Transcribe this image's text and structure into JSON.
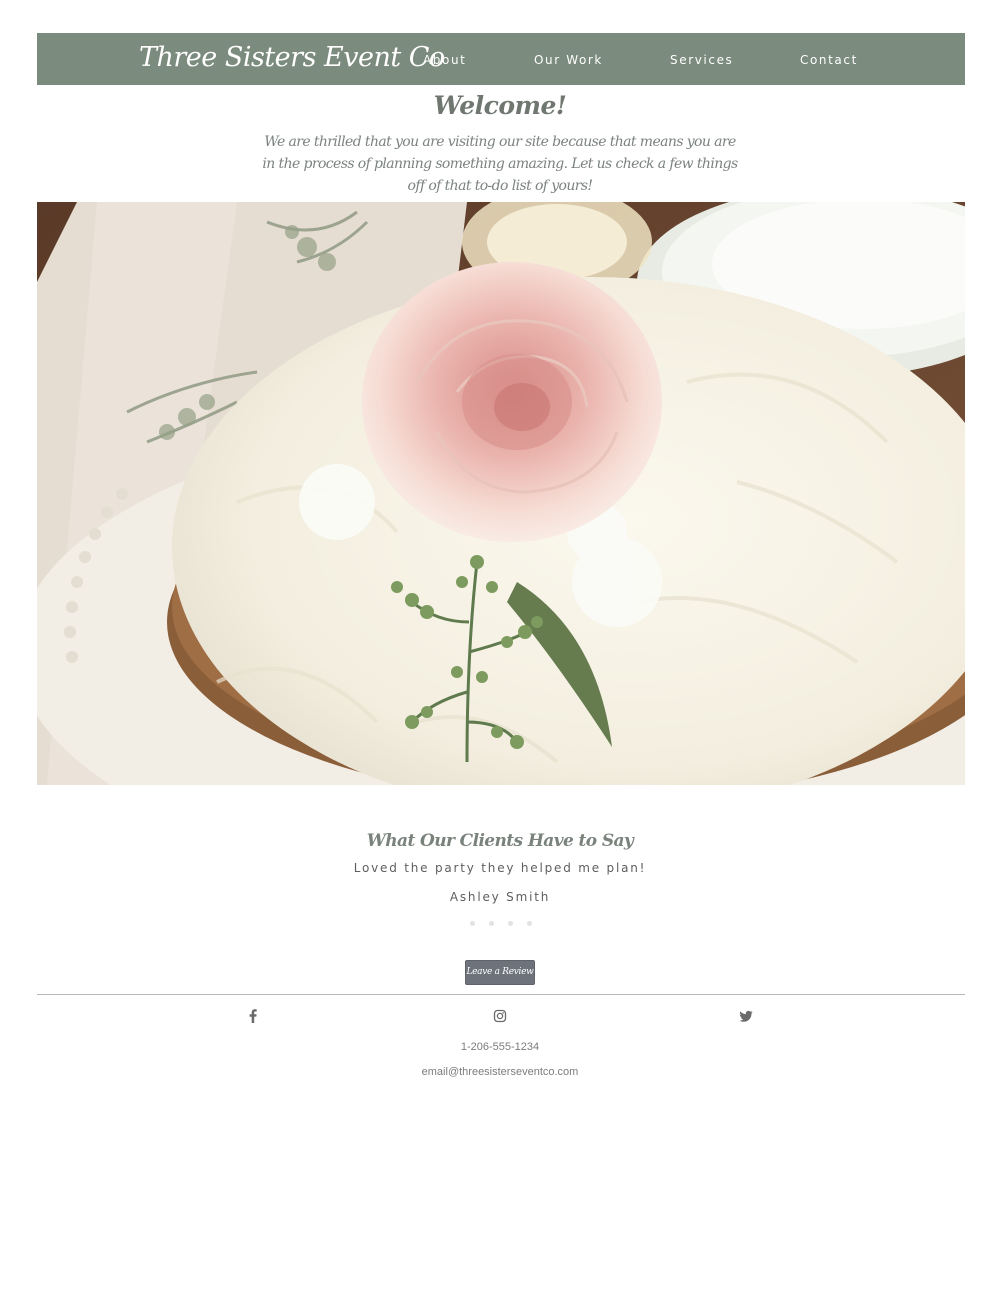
{
  "header": {
    "brand": "Three Sisters Event Co",
    "nav": [
      {
        "label": "About"
      },
      {
        "label": "Our Work"
      },
      {
        "label": "Services"
      },
      {
        "label": "Contact"
      }
    ],
    "background_color": "#7b8b7d"
  },
  "welcome": {
    "title": "Welcome!",
    "text": "We are thrilled that you are visiting our site because that means you are in the process of planning something amazing. Let us check a few things off of that to-do list of yours!"
  },
  "testimonials": {
    "heading": "What Our Clients Have to Say",
    "quote": "Loved the party they helped me plan!",
    "author": "Ashley Smith",
    "slide_count": 4,
    "review_button_label": "Leave a Review"
  },
  "footer": {
    "social_icons": [
      "facebook-icon",
      "instagram-icon",
      "twitter-icon"
    ],
    "phone": "1-206-555-1234",
    "email": "email@threesisterseventco.com"
  },
  "colors": {
    "nav_bg": "#7b8b7d",
    "button_bg": "#6e727b",
    "heading_text": "#6f7770"
  }
}
